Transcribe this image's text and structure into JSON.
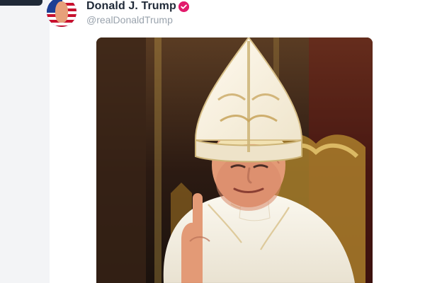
{
  "post": {
    "author": {
      "display_name": "Donald J. Trump",
      "handle": "@realDonaldTrump",
      "verified_badge_color": "#e21b6c",
      "avatar_icon": "flag-portrait-avatar"
    }
  },
  "colors": {
    "name": "#1f2937",
    "handle": "#9aa3ad",
    "page_bg": "#f3f4f6",
    "card_bg": "#ffffff"
  }
}
